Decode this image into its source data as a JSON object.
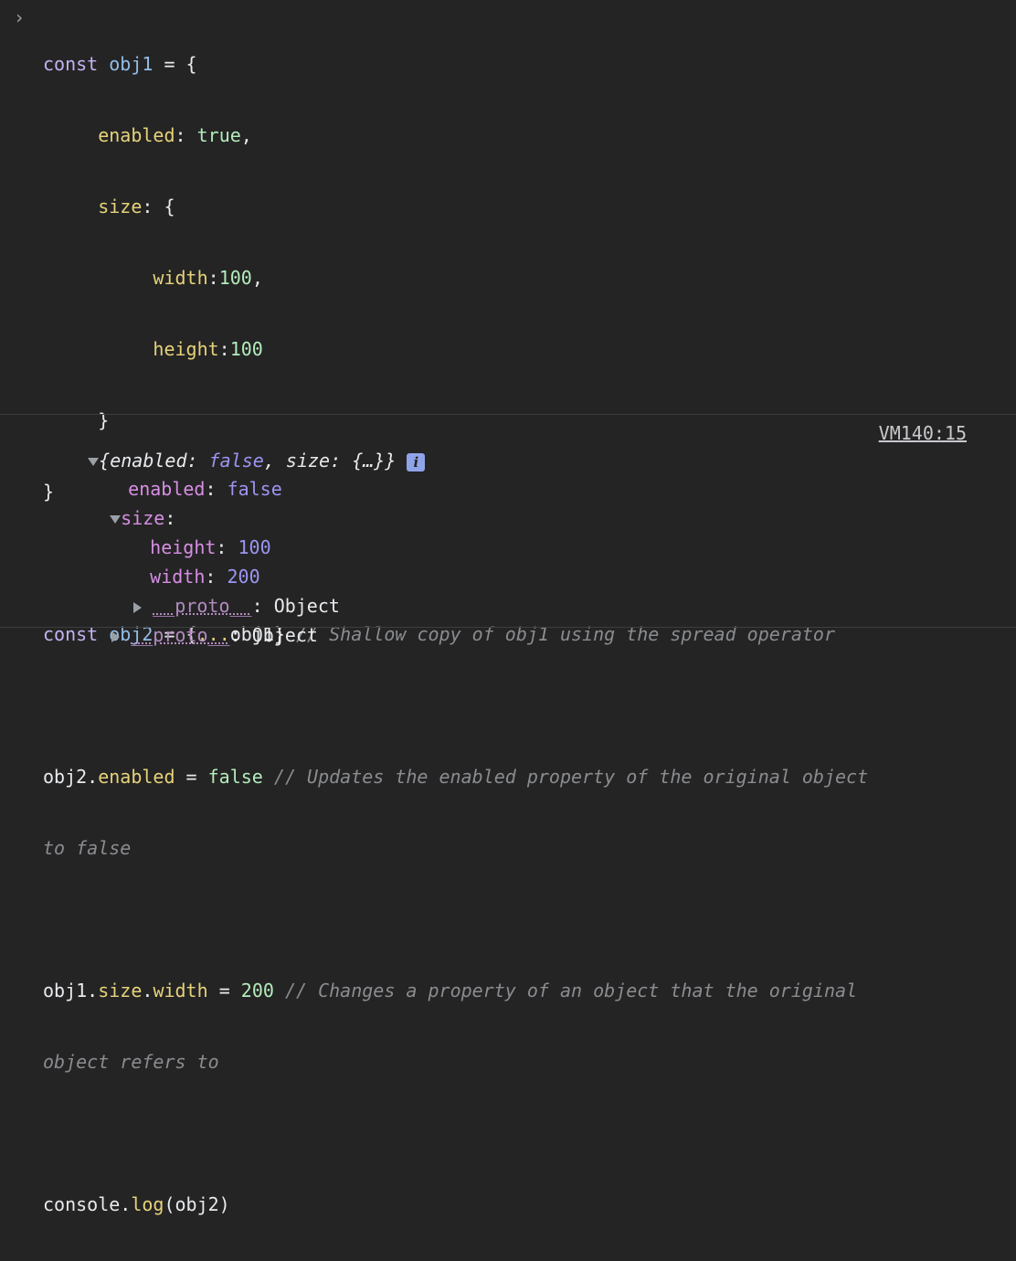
{
  "prompt": {
    "symbol": "›"
  },
  "input": {
    "line1": {
      "kw": "const",
      "var": "obj1",
      "rest": " = {"
    },
    "line2": {
      "prop": "enabled",
      "sep": ": ",
      "val": "true",
      "end": ","
    },
    "line3": {
      "prop": "size",
      "sep": ": {"
    },
    "line4": {
      "prop": "width",
      "sep": ":",
      "val": "100",
      "end": ","
    },
    "line5": {
      "prop": "height",
      "sep": ":",
      "val": "100"
    },
    "line6": {
      "text": "}"
    },
    "line7": {
      "text": "}"
    },
    "line9": {
      "kw": "const",
      "var": "obj2",
      "mid": " = {",
      "spread": "...",
      "ref": "obj1",
      "close": "}",
      "comment": " // Shallow copy of obj1 using the spread operator"
    },
    "line11": {
      "obj": "obj2",
      "dot": ".",
      "prop": "enabled",
      "eq": " = ",
      "val": "false",
      "comment": " // Updates the enabled property of the original object"
    },
    "line12": {
      "comment": "to false"
    },
    "line14": {
      "obj": "obj1",
      "dot1": ".",
      "prop1": "size",
      "dot2": ".",
      "prop2": "width",
      "eq": " = ",
      "val": "200",
      "comment": " // Changes a property of an object that the original"
    },
    "line15": {
      "comment": "object refers to"
    },
    "line17": {
      "obj": "console",
      "dot": ".",
      "fn": "log",
      "args": "(obj2)"
    }
  },
  "output": {
    "preview_open": "{",
    "preview_k1": "enabled",
    "preview_sep1": ": ",
    "preview_v1": "false",
    "preview_comma": ", ",
    "preview_k2": "size",
    "preview_sep2": ": ",
    "preview_v2": "{…}",
    "preview_close": "}",
    "info": "i",
    "source": "VM140:15",
    "enabled_key": "enabled",
    "enabled_val": "false",
    "size_key": "size",
    "height_key": "height",
    "height_val": "100",
    "width_key": "width",
    "width_val": "200",
    "proto_key": "__proto__",
    "proto_val": "Object",
    "colon": ": ",
    "colon_short": ":"
  },
  "colors": {
    "background": "#242424",
    "keyword": "#c3b3f2",
    "variable": "#94bde6",
    "property": "#e6d27a",
    "value": "#b4ecbb",
    "comment": "#8a8c90",
    "object_key": "#d78ee5",
    "object_value": "#9c95f2",
    "info_badge": "#8fa3e9"
  }
}
